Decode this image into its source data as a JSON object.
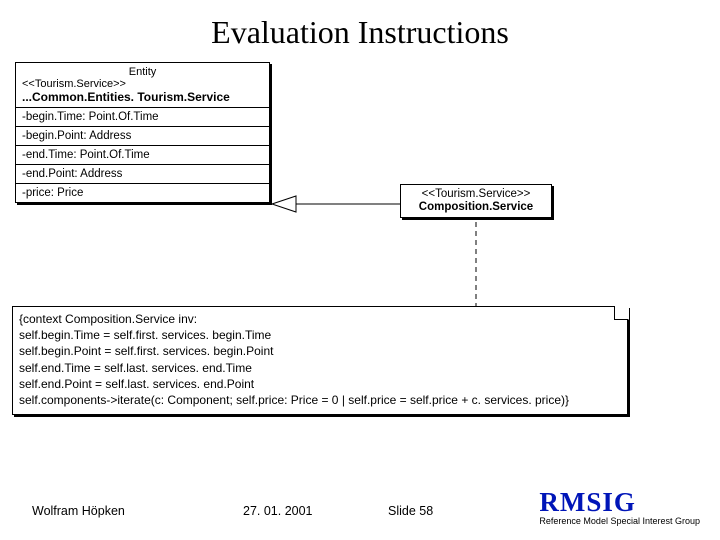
{
  "title": "Evaluation Instructions",
  "entity": {
    "label": "Entity",
    "stereotype": "<<Tourism.Service>>",
    "classname": "...Common.Entities. Tourism.Service",
    "attributes": [
      "-begin.Time: Point.Of.Time",
      "-begin.Point: Address",
      "-end.Time: Point.Of.Time",
      "-end.Point: Address",
      "-price: Price"
    ]
  },
  "composition": {
    "stereotype": "<<Tourism.Service>>",
    "classname": "Composition.Service"
  },
  "constraint": {
    "lines": [
      "{context Composition.Service inv:",
      "self.begin.Time = self.first. services. begin.Time",
      "self.begin.Point = self.first. services. begin.Point",
      "self.end.Time = self.last. services. end.Time",
      "self.end.Point = self.last. services. end.Point",
      "self.components->iterate(c: Component; self.price: Price = 0 | self.price = self.price + c. services. price)}"
    ]
  },
  "footer": {
    "author": "Wolfram Höpken",
    "date": "27. 01. 2001",
    "slide": "Slide 58",
    "logo_big": "RMSIG",
    "logo_sub": "Reference Model Special Interest Group"
  }
}
